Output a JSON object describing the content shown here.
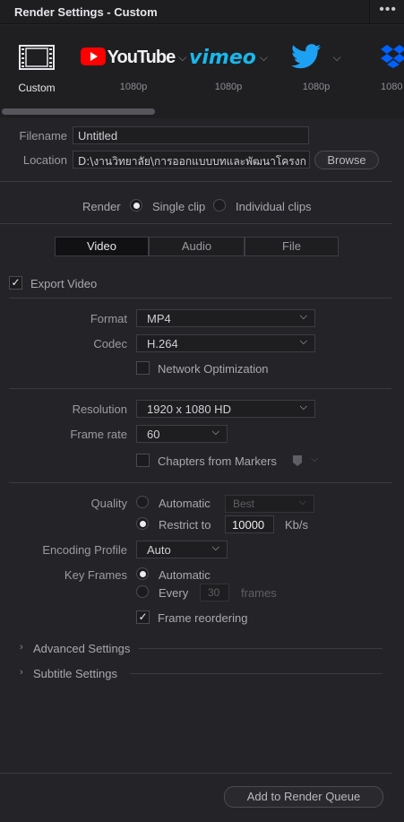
{
  "window": {
    "title": "Render Settings - Custom",
    "menu_icon": "more-dots-icon"
  },
  "presets": [
    {
      "label": "Custom",
      "icon": "film-icon"
    },
    {
      "label": "1080p",
      "brand": "YouTube",
      "icon": "youtube-icon"
    },
    {
      "label": "1080p",
      "brand": "vimeo",
      "icon": "vimeo-icon"
    },
    {
      "label": "1080p",
      "icon": "twitter-icon"
    },
    {
      "label": "1080",
      "icon": "dropbox-icon"
    }
  ],
  "file": {
    "filename_label": "Filename",
    "filename_value": "Untitled",
    "location_label": "Location",
    "location_value": "D:\\งานวิทยาลัย\\การออกแบบบทและพัฒนาโครงก",
    "browse_label": "Browse"
  },
  "render_mode": {
    "label": "Render",
    "single_clip": "Single clip",
    "individual_clips": "Individual clips",
    "selected": "Single clip"
  },
  "tabs": [
    "Video",
    "Audio",
    "File"
  ],
  "active_tab": "Video",
  "export_video": {
    "label": "Export Video",
    "checked": true
  },
  "format": {
    "label": "Format",
    "value": "MP4"
  },
  "codec": {
    "label": "Codec",
    "value": "H.264"
  },
  "network_optimization": {
    "label": "Network Optimization",
    "checked": false
  },
  "resolution": {
    "label": "Resolution",
    "value": "1920 x 1080 HD"
  },
  "frame_rate": {
    "label": "Frame rate",
    "value": "60"
  },
  "chapters": {
    "label": "Chapters from Markers",
    "checked": false
  },
  "quality": {
    "label": "Quality",
    "automatic": "Automatic",
    "automatic_value": "Best",
    "restrict": "Restrict to",
    "restrict_value": "10000",
    "unit": "Kb/s",
    "selected": "Restrict to"
  },
  "encoding_profile": {
    "label": "Encoding Profile",
    "value": "Auto"
  },
  "key_frames": {
    "label": "Key Frames",
    "automatic": "Automatic",
    "every": "Every",
    "every_value": "30",
    "unit": "frames",
    "selected": "Automatic"
  },
  "frame_reordering": {
    "label": "Frame reordering",
    "checked": true
  },
  "sections": [
    "Advanced Settings",
    "Subtitle Settings"
  ],
  "footer": {
    "add_button": "Add to Render Queue"
  },
  "colors": {
    "accent_twitter": "#1da1f2",
    "accent_vimeo": "#1ab7ea",
    "accent_youtube": "#ff0000",
    "accent_dropbox": "#0061fe"
  }
}
